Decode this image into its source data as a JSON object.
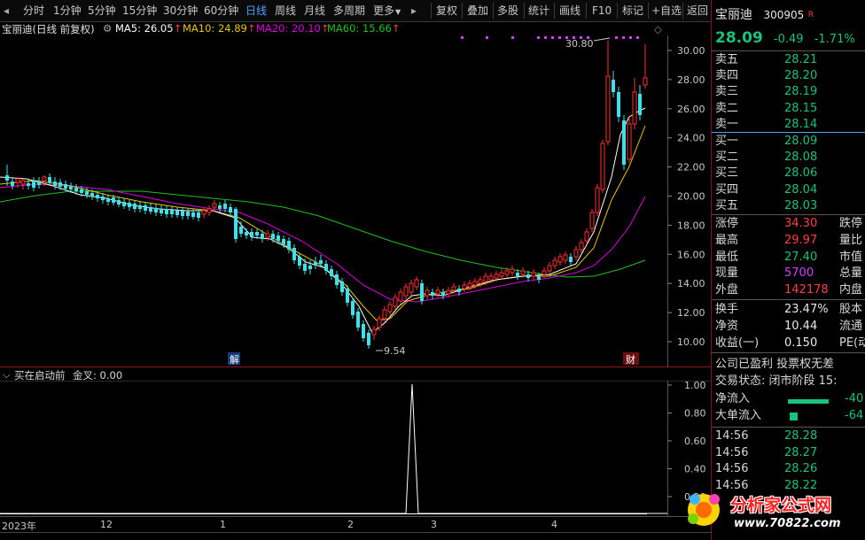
{
  "toolbar": {
    "periods": [
      "分时",
      "1分钟",
      "5分钟",
      "15分钟",
      "30分钟",
      "60分钟",
      "日线",
      "周线",
      "月线",
      "多周期",
      "更多"
    ],
    "active_period": "日线",
    "more_arrow": "▼",
    "actions": [
      "复权",
      "叠加",
      "多股",
      "统计",
      "画线",
      "F10",
      "标记",
      "+自选",
      "返回"
    ]
  },
  "chart": {
    "title": "宝丽迪(日线 前复权)",
    "ma5": "MA5: 26.05",
    "ma10": "MA10: 24.89",
    "ma20": "MA20: 20.10",
    "ma60": "MA60: 15.66",
    "ma_arrow": "↑",
    "high_label": "30.80",
    "low_label": "9.54",
    "marker_jie": "解",
    "marker_cai": "财",
    "price_ticks": [
      "30.00",
      "28.00",
      "26.00",
      "24.00",
      "22.00",
      "20.00",
      "18.00",
      "16.00",
      "14.00",
      "12.00",
      "10.00"
    ],
    "colors": {
      "ma5": "#ffffff",
      "ma10": "#e8c800",
      "ma20": "#e000e0",
      "ma60": "#20c020",
      "up": "#ff3030",
      "down": "#40e0e8",
      "accent": "#ff4040"
    }
  },
  "indicator": {
    "title": "买在启动前",
    "value": "金叉: 0.00",
    "ticks": [
      "1.00",
      "0.80",
      "0.60",
      "0.40",
      "0.20"
    ]
  },
  "date_axis": [
    "2023年",
    "12",
    "1",
    "2",
    "3",
    "4"
  ],
  "quote": {
    "name": "宝丽迪",
    "code": "300905",
    "flag": "R",
    "price": "28.09",
    "change": "-0.49",
    "change_pct": "-1.71%",
    "asks": [
      {
        "label": "卖五",
        "price": "28.21"
      },
      {
        "label": "卖四",
        "price": "28.20"
      },
      {
        "label": "卖三",
        "price": "28.19"
      },
      {
        "label": "卖二",
        "price": "28.15"
      },
      {
        "label": "卖一",
        "price": "28.14"
      }
    ],
    "bids": [
      {
        "label": "买一",
        "price": "28.09"
      },
      {
        "label": "买二",
        "price": "28.08"
      },
      {
        "label": "买三",
        "price": "28.06"
      },
      {
        "label": "买四",
        "price": "28.04"
      },
      {
        "label": "买五",
        "price": "28.03"
      }
    ],
    "stats": [
      {
        "label": "涨停",
        "value": "34.30",
        "label2": "跌停",
        "color": "red"
      },
      {
        "label": "最高",
        "value": "29.97",
        "label2": "量比",
        "color": "red"
      },
      {
        "label": "最低",
        "value": "27.40",
        "label2": "市值",
        "color": "green"
      },
      {
        "label": "现量",
        "value": "5700",
        "label2": "总量",
        "color": "purple"
      },
      {
        "label": "外盘",
        "value": "142178",
        "label2": "内盘",
        "color": "red"
      }
    ],
    "stats2": [
      {
        "label": "换手",
        "value": "23.47%",
        "label2": "股本"
      },
      {
        "label": "净资",
        "value": "10.44",
        "label2": "流通"
      },
      {
        "label": "收益(一)",
        "value": "0.150",
        "label2": "PE(动"
      }
    ],
    "info1": "公司已盈利 投票权无差",
    "info2": "交易状态: 闭市阶段 15:",
    "netflow_label": "净流入",
    "netflow_value": "-40",
    "bigflow_label": "大单流入",
    "bigflow_value": "-64",
    "ticks": [
      {
        "time": "14:56",
        "price": "28.28"
      },
      {
        "time": "14:56",
        "price": "28.27"
      },
      {
        "time": "14:56",
        "price": "28.26"
      },
      {
        "time": "14:56",
        "price": "28.22"
      }
    ]
  },
  "watermark": {
    "text": "分析家公式网",
    "url": "www.70822.com"
  }
}
